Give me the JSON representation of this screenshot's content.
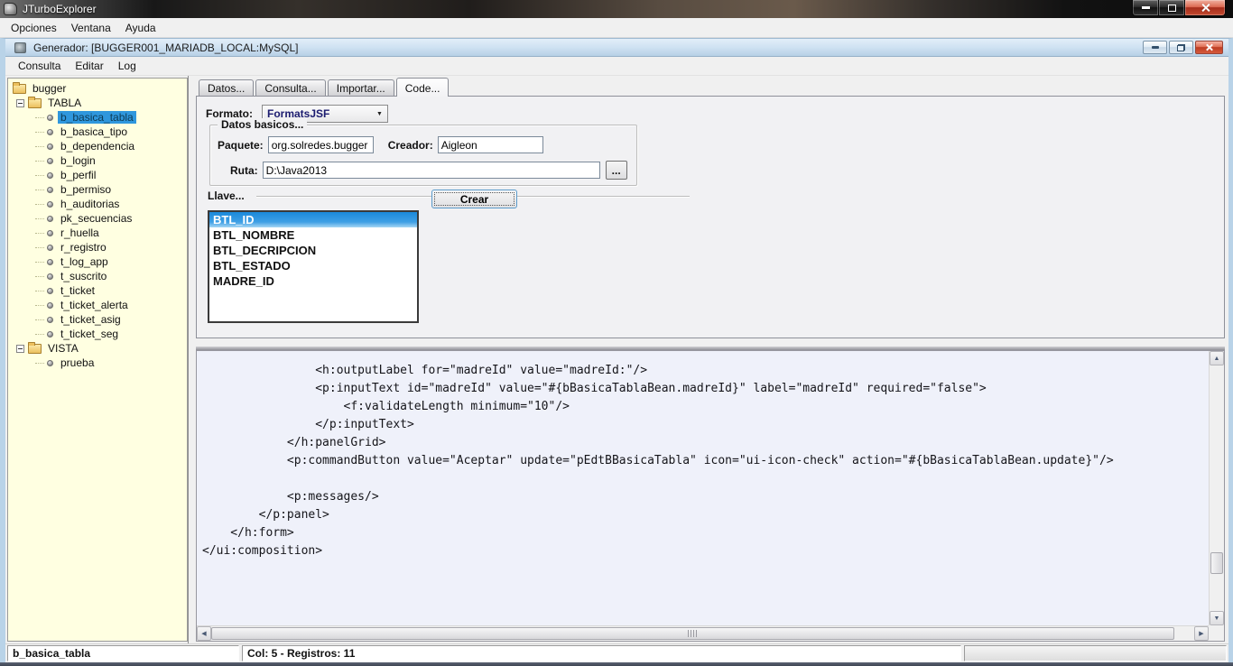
{
  "window": {
    "title": "JTurboExplorer",
    "menu": [
      "Opciones",
      "Ventana",
      "Ayuda"
    ]
  },
  "mdi": {
    "title": "Generador: [BUGGER001_MARIADB_LOCAL:MySQL]",
    "menu": [
      "Consulta",
      "Editar",
      "Log"
    ]
  },
  "tree": {
    "rows": [
      {
        "type": "root",
        "label": "bugger"
      },
      {
        "type": "group",
        "label": "TABLA"
      },
      {
        "type": "leaf",
        "label": "b_basica_tabla",
        "selected": true
      },
      {
        "type": "leaf",
        "label": "b_basica_tipo"
      },
      {
        "type": "leaf",
        "label": "b_dependencia"
      },
      {
        "type": "leaf",
        "label": "b_login"
      },
      {
        "type": "leaf",
        "label": "b_perfil"
      },
      {
        "type": "leaf",
        "label": "b_permiso"
      },
      {
        "type": "leaf",
        "label": "h_auditorias"
      },
      {
        "type": "leaf",
        "label": "pk_secuencias"
      },
      {
        "type": "leaf",
        "label": "r_huella"
      },
      {
        "type": "leaf",
        "label": "r_registro"
      },
      {
        "type": "leaf",
        "label": "t_log_app"
      },
      {
        "type": "leaf",
        "label": "t_suscrito"
      },
      {
        "type": "leaf",
        "label": "t_ticket"
      },
      {
        "type": "leaf",
        "label": "t_ticket_alerta"
      },
      {
        "type": "leaf",
        "label": "t_ticket_asig"
      },
      {
        "type": "leaf",
        "label": "t_ticket_seg"
      },
      {
        "type": "group",
        "label": "VISTA"
      },
      {
        "type": "leaf",
        "label": "prueba"
      }
    ]
  },
  "tabs": [
    {
      "label": "Datos..."
    },
    {
      "label": "Consulta..."
    },
    {
      "label": "Importar..."
    },
    {
      "label": "Code...",
      "selected": true
    }
  ],
  "form": {
    "formato_label": "Formato:",
    "formato_value": "FormatsJSF",
    "group_title": "Datos basicos...",
    "paquete_label": "Paquete:",
    "paquete_value": "org.solredes.bugger",
    "creador_label": "Creador:",
    "creador_value": "Aigleon",
    "ruta_label": "Ruta:",
    "ruta_value": "D:\\Java2013",
    "browse_label": "...",
    "llave_label": "Llave...",
    "keys": [
      {
        "label": "BTL_ID",
        "selected": true
      },
      {
        "label": "BTL_NOMBRE"
      },
      {
        "label": "BTL_DECRIPCION"
      },
      {
        "label": "BTL_ESTADO"
      },
      {
        "label": "MADRE_ID"
      }
    ],
    "crear_label": "Crear"
  },
  "code": {
    "lines": [
      "                <h:outputLabel for=\"madreId\" value=\"madreId:\"/>",
      "                <p:inputText id=\"madreId\" value=\"#{bBasicaTablaBean.madreId}\" label=\"madreId\" required=\"false\">",
      "                    <f:validateLength minimum=\"10\"/>",
      "                </p:inputText>",
      "            </h:panelGrid>",
      "            <p:commandButton value=\"Aceptar\" update=\"pEdtBBasicaTabla\" icon=\"ui-icon-check\" action=\"#{bBasicaTablaBean.update}\"/>",
      "",
      "            <p:messages/>",
      "        </p:panel>",
      "    </h:form>",
      "</ui:composition>"
    ]
  },
  "statusbar": {
    "table": "b_basica_tabla",
    "info": "Col: 5 - Registros: 11"
  },
  "icons": {
    "combo_arrow": "▼",
    "scroll_up": "▲",
    "scroll_down": "▼",
    "scroll_left": "◀",
    "scroll_right": "▶"
  },
  "colors": {
    "tree_panel_bg": "#ffffe1",
    "tree_selection": "#2f97dd",
    "list_selection": "#1a89da",
    "mdi_titlebar": "#cfe2f2",
    "close_button_red": "#bd3c22",
    "combo_text": "#1b1b6f"
  }
}
